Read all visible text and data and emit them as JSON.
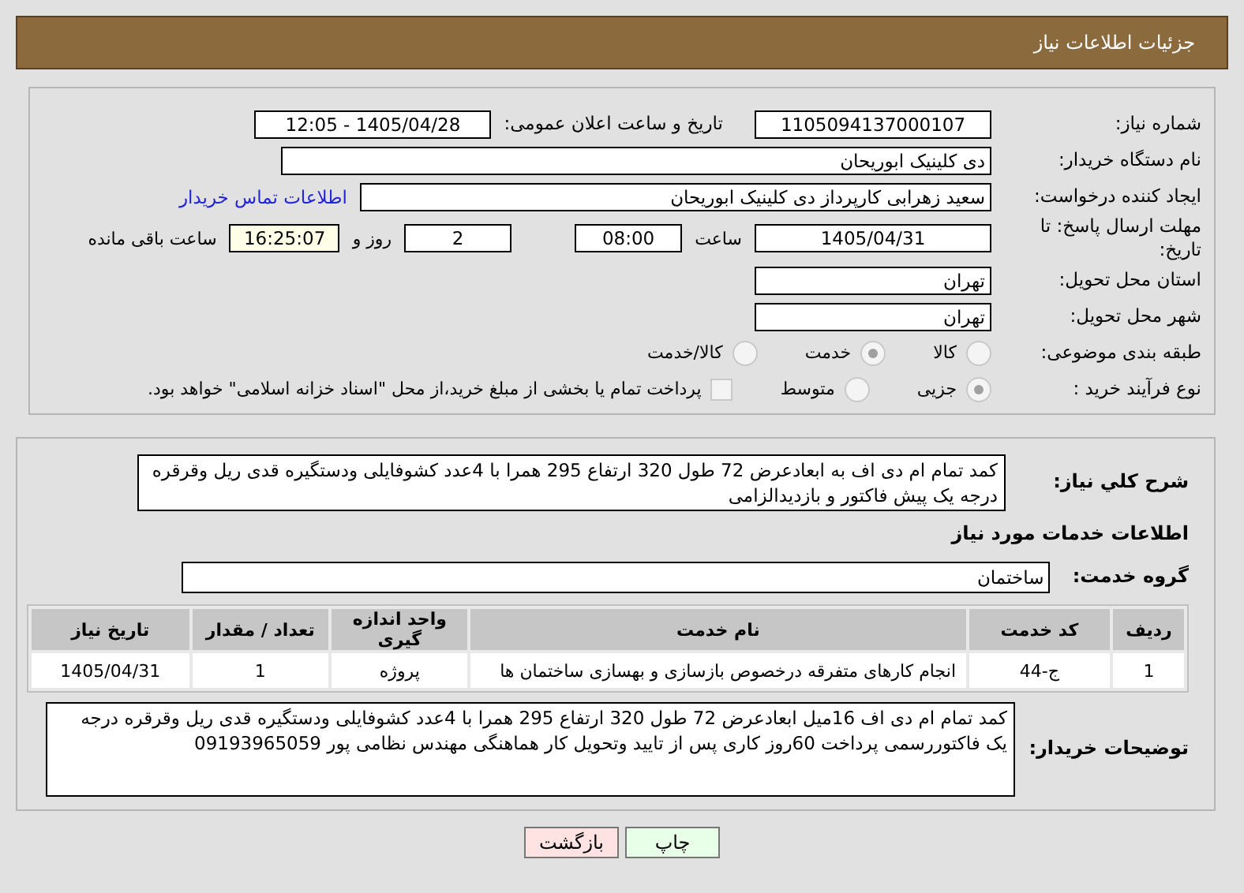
{
  "header": {
    "title": "جزئیات اطلاعات نیاز"
  },
  "need_number": {
    "label": "شماره نیاز:",
    "value": "1105094137000107"
  },
  "announce": {
    "label": "تاریخ و ساعت اعلان عمومی:",
    "value": "1405/04/28 - 12:05"
  },
  "buyer_org": {
    "label": "نام دستگاه خریدار:",
    "value": "دی کلینیک ابوریحان"
  },
  "creator": {
    "label": "ایجاد کننده درخواست:",
    "value": "سعید زهرابی کارپرداز دی کلینیک ابوریحان",
    "link": "اطلاعات تماس خریدار"
  },
  "deadline": {
    "label": "مهلت ارسال پاسخ: تا تاریخ:",
    "date": "1405/04/31",
    "time_label": "ساعت",
    "time": "08:00",
    "days": "2",
    "days_label": "روز و",
    "remaining": "16:25:07",
    "remaining_label": "ساعت باقی مانده"
  },
  "province": {
    "label": "استان محل تحویل:",
    "value": "تهران"
  },
  "city": {
    "label": "شهر محل تحویل:",
    "value": "تهران"
  },
  "category": {
    "label": "طبقه بندی موضوعی:",
    "options": [
      {
        "label": "کالا",
        "selected": false
      },
      {
        "label": "خدمت",
        "selected": true
      },
      {
        "label": "کالا/خدمت",
        "selected": false
      }
    ]
  },
  "process": {
    "label": "نوع فرآیند خرید :",
    "options": [
      {
        "label": "جزیی",
        "selected": true
      },
      {
        "label": "متوسط",
        "selected": false
      }
    ],
    "treasury": {
      "label": "پرداخت تمام یا بخشی از مبلغ خرید،از محل \"اسناد خزانه اسلامی\" خواهد بود.",
      "checked": false
    }
  },
  "description": {
    "label": "شرح کلي نیاز:",
    "value": "کمد تمام ام دی اف به ابعادعرض 72 طول 320 ارتفاع 295 همرا با 4عدد کشوفایلی ودستگیره قدی ریل وقرقره درجه یک پیش فاکتور و بازدیدالزامی"
  },
  "services_heading": "اطلاعات خدمات مورد نیاز",
  "service_group": {
    "label": "گروه خدمت:",
    "value": "ساختمان"
  },
  "table": {
    "columns": [
      "ردیف",
      "کد خدمت",
      "نام خدمت",
      "واحد اندازه گیری",
      "تعداد / مقدار",
      "تاریخ نیاز"
    ],
    "rows": [
      [
        "1",
        "ج-44",
        "انجام کارهای متفرقه درخصوص بازسازی و بهسازی ساختمان ها",
        "پروژه",
        "1",
        "1405/04/31"
      ]
    ]
  },
  "buyer_notes": {
    "label": "توضیحات خریدار:",
    "value": "کمد تمام ام دی اف  16میل ابعادعرض 72 طول 320 ارتفاع 295 همرا با 4عدد کشوفایلی ودستگیره قدی ریل وقرقره درجه یک فاکتوررسمی پرداخت 60روز کاری پس از تایید وتحویل کار هماهنگی مهندس نظامی پور 09193965059"
  },
  "buttons": [
    {
      "label": "چاپ",
      "kind": "print"
    },
    {
      "label": "بازگشت",
      "kind": "back"
    }
  ]
}
